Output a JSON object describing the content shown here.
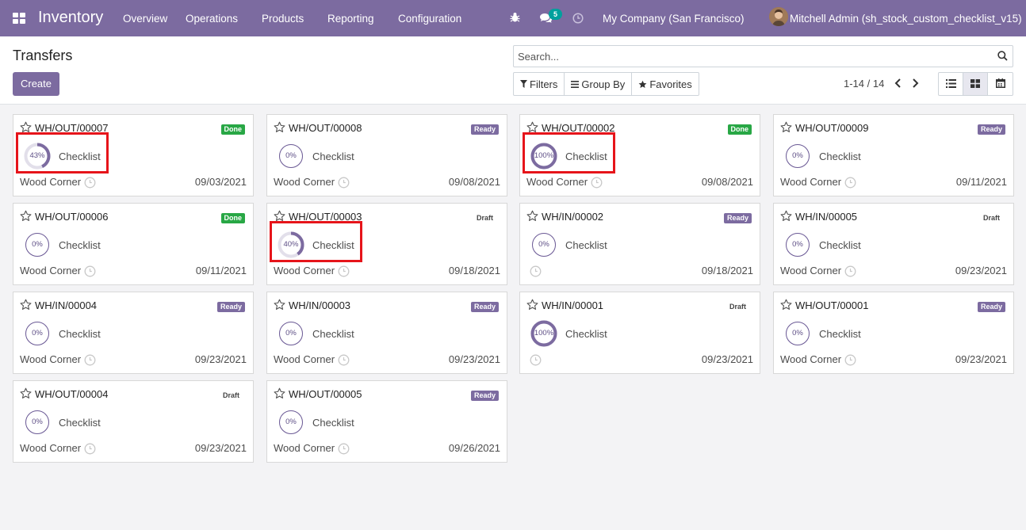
{
  "navbar": {
    "app_title": "Inventory",
    "menu": [
      "Overview",
      "Operations",
      "Products",
      "Reporting",
      "Configuration"
    ],
    "chat_count": "5",
    "company": "My Company (San Francisco)",
    "user": "Mitchell Admin (sh_stock_custom_checklist_v15)",
    "bg_color": "#7c6ba0"
  },
  "control": {
    "title": "Transfers",
    "create_label": "Create",
    "search_placeholder": "Search...",
    "filters_label": "Filters",
    "groupby_label": "Group By",
    "favorites_label": "Favorites",
    "pager": "1-14 / 14"
  },
  "colors": {
    "done": "#28a745",
    "ready": "#7c6ba0",
    "highlight": "#e6141a",
    "progress": "#7c6ba0"
  },
  "checklist_label": "Checklist",
  "cards": [
    {
      "ref": "WH/OUT/00007",
      "status": "Done",
      "status_class": "done",
      "progress": 43,
      "progress_label": "43%",
      "partner": "Wood Corner",
      "date": "09/03/2021",
      "highlighted": true
    },
    {
      "ref": "WH/OUT/00008",
      "status": "Ready",
      "status_class": "ready",
      "progress": 0,
      "progress_label": "0%",
      "partner": "Wood Corner",
      "date": "09/08/2021",
      "highlighted": false
    },
    {
      "ref": "WH/OUT/00002",
      "status": "Done",
      "status_class": "done",
      "progress": 100,
      "progress_label": "100%",
      "partner": "Wood Corner",
      "date": "09/08/2021",
      "highlighted": true
    },
    {
      "ref": "WH/OUT/00009",
      "status": "Ready",
      "status_class": "ready",
      "progress": 0,
      "progress_label": "0%",
      "partner": "Wood Corner",
      "date": "09/11/2021",
      "highlighted": false
    },
    {
      "ref": "WH/OUT/00006",
      "status": "Done",
      "status_class": "done",
      "progress": 0,
      "progress_label": "0%",
      "partner": "Wood Corner",
      "date": "09/11/2021",
      "highlighted": false
    },
    {
      "ref": "WH/OUT/00003",
      "status": "Draft",
      "status_class": "draft",
      "progress": 40,
      "progress_label": "40%",
      "partner": "Wood Corner",
      "date": "09/18/2021",
      "highlighted": true
    },
    {
      "ref": "WH/IN/00002",
      "status": "Ready",
      "status_class": "ready",
      "progress": 0,
      "progress_label": "0%",
      "partner": "",
      "date": "09/18/2021",
      "highlighted": false
    },
    {
      "ref": "WH/IN/00005",
      "status": "Draft",
      "status_class": "draft",
      "progress": 0,
      "progress_label": "0%",
      "partner": "Wood Corner",
      "date": "09/23/2021",
      "highlighted": false
    },
    {
      "ref": "WH/IN/00004",
      "status": "Ready",
      "status_class": "ready",
      "progress": 0,
      "progress_label": "0%",
      "partner": "Wood Corner",
      "date": "09/23/2021",
      "highlighted": false
    },
    {
      "ref": "WH/IN/00003",
      "status": "Ready",
      "status_class": "ready",
      "progress": 0,
      "progress_label": "0%",
      "partner": "Wood Corner",
      "date": "09/23/2021",
      "highlighted": false
    },
    {
      "ref": "WH/IN/00001",
      "status": "Draft",
      "status_class": "draft",
      "progress": 100,
      "progress_label": "100%",
      "partner": "",
      "date": "09/23/2021",
      "highlighted": false
    },
    {
      "ref": "WH/OUT/00001",
      "status": "Ready",
      "status_class": "ready",
      "progress": 0,
      "progress_label": "0%",
      "partner": "Wood Corner",
      "date": "09/23/2021",
      "highlighted": false
    },
    {
      "ref": "WH/OUT/00004",
      "status": "Draft",
      "status_class": "draft",
      "progress": 0,
      "progress_label": "0%",
      "partner": "Wood Corner",
      "date": "09/23/2021",
      "highlighted": false
    },
    {
      "ref": "WH/OUT/00005",
      "status": "Ready",
      "status_class": "ready",
      "progress": 0,
      "progress_label": "0%",
      "partner": "Wood Corner",
      "date": "09/26/2021",
      "highlighted": false
    }
  ]
}
